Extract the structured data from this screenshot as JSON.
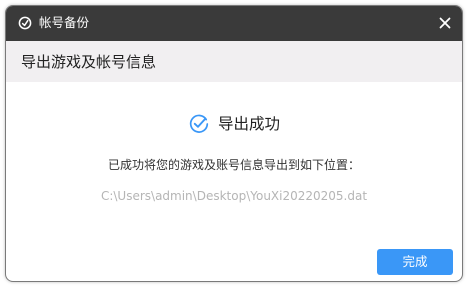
{
  "window": {
    "title": "帐号备份",
    "app_icon": "refresh-circle-icon",
    "close_icon": "close-icon"
  },
  "header": {
    "title": "导出游戏及帐号信息"
  },
  "status": {
    "icon": "checkmark-circle-icon",
    "text": "导出成功"
  },
  "message": "已成功将您的游戏及账号信息导出到如下位置：",
  "file_path": "C:\\Users\\admin\\Desktop\\YouXi20220205.dat",
  "actions": {
    "done_label": "完成"
  },
  "colors": {
    "titlebar": "#3a3a3a",
    "header_bg": "#f1eff1",
    "accent": "#3a97f7",
    "path_text": "#b5b5b5"
  }
}
